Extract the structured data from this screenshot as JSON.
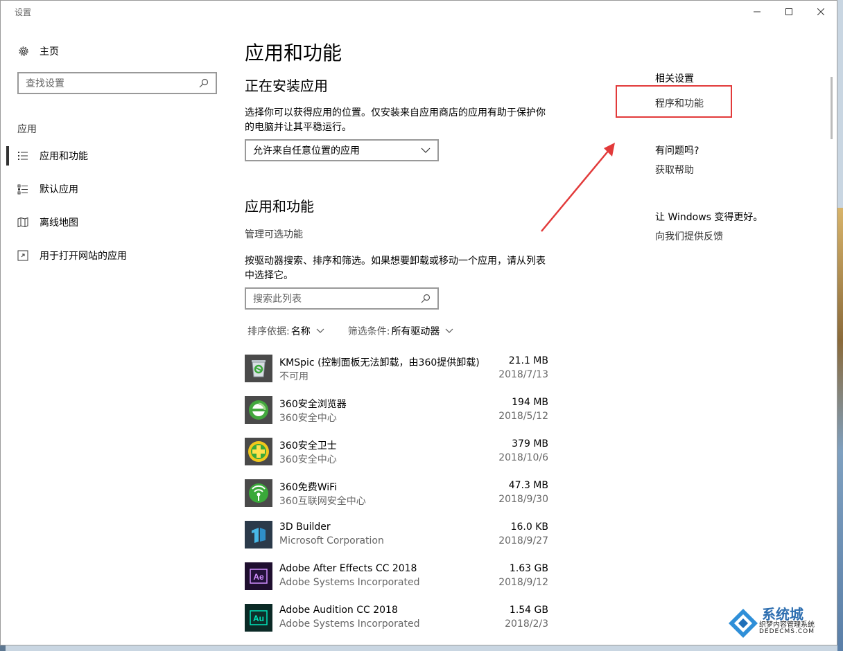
{
  "window": {
    "title": "设置"
  },
  "sidebar": {
    "home_label": "主页",
    "search_placeholder": "查找设置",
    "section_label": "应用",
    "items": [
      {
        "label": "应用和功能",
        "icon": "apps-list-icon",
        "active": true
      },
      {
        "label": "默认应用",
        "icon": "default-apps-icon"
      },
      {
        "label": "离线地图",
        "icon": "offline-maps-icon"
      },
      {
        "label": "用于打开网站的应用",
        "icon": "web-apps-icon"
      }
    ]
  },
  "main": {
    "title": "应用和功能",
    "install_heading": "正在安装应用",
    "install_desc": "选择你可以获得应用的位置。仅安装来自应用商店的应用有助于保护你的电脑并让其平稳运行。",
    "install_dropdown_value": "允许来自任意位置的应用",
    "apps_heading": "应用和功能",
    "manage_optional": "管理可选功能",
    "apps_desc": "按驱动器搜索、排序和筛选。如果想要卸载或移动一个应用，请从列表中选择它。",
    "list_search_placeholder": "搜索此列表",
    "sort_label": "排序依据:",
    "sort_value": "名称",
    "filter_label": "筛选条件:",
    "filter_value": "所有驱动器",
    "apps": [
      {
        "name": " KMSpic (控制面板无法卸载，由360提供卸载)",
        "publisher": "不可用",
        "size": "21.1 MB",
        "date": "2018/7/13",
        "icon": "recycle-bin-icon"
      },
      {
        "name": "360安全浏览器",
        "publisher": "360安全中心",
        "size": "194 MB",
        "date": "2018/5/12",
        "icon": "360-browser-icon"
      },
      {
        "name": "360安全卫士",
        "publisher": "360安全中心",
        "size": "379 MB",
        "date": "2018/10/6",
        "icon": "360-safeguard-icon"
      },
      {
        "name": "360免费WiFi",
        "publisher": "360互联网安全中心",
        "size": "47.3 MB",
        "date": "2018/9/30",
        "icon": "360-wifi-icon"
      },
      {
        "name": "3D Builder",
        "publisher": "Microsoft Corporation",
        "size": "16.0 KB",
        "date": "2018/9/27",
        "icon": "3d-builder-icon"
      },
      {
        "name": "Adobe After Effects CC 2018",
        "publisher": "Adobe Systems Incorporated",
        "size": "1.63 GB",
        "date": "2018/9/12",
        "icon": "after-effects-icon",
        "glyph": "Ae"
      },
      {
        "name": "Adobe Audition CC 2018",
        "publisher": "Adobe Systems Incorporated",
        "size": "1.54 GB",
        "date": "2018/2/3",
        "icon": "audition-icon",
        "glyph": "Au"
      }
    ]
  },
  "related": {
    "heading": "相关设置",
    "programs_link": "程序和功能",
    "question_heading": "有问题吗?",
    "help_link": "获取帮助",
    "improve_heading": "让 Windows 变得更好。",
    "feedback_link": "向我们提供反馈"
  },
  "watermark": {
    "brand": "系统城",
    "sub": "织梦内容管理系统",
    "url": "DEDECMS.COM"
  },
  "colors": {
    "highlight": "#e23a3a",
    "ae_purple": "#d18fff",
    "au_green": "#00e4bb",
    "icon_green": "#3aa93a"
  }
}
